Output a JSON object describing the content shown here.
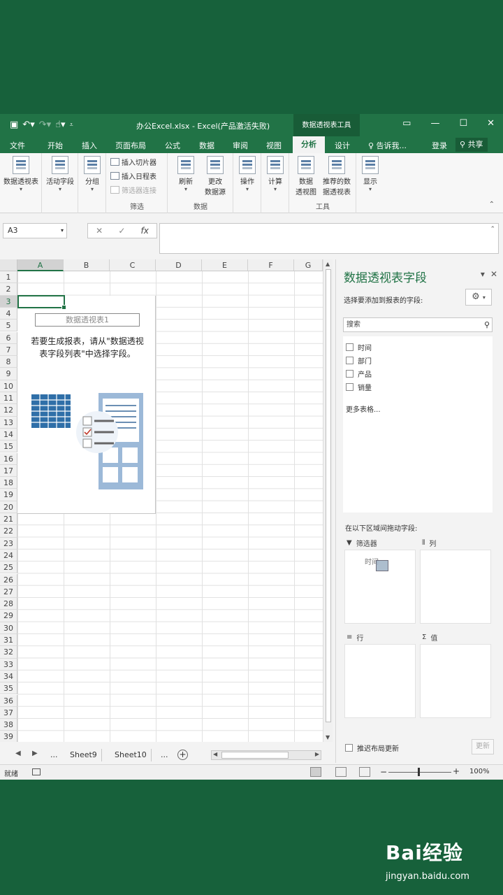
{
  "app": {
    "document_title": "办公Excel.xlsx - Excel(产品激活失败)",
    "context_tab": "数据透视表工具"
  },
  "ribbon_tabs": [
    "文件",
    "开始",
    "插入",
    "页面布局",
    "公式",
    "数据",
    "审阅",
    "视图",
    "分析",
    "设计"
  ],
  "tell_me": "♀ 告诉我...",
  "login": "登录",
  "share": "共享",
  "ribbon": {
    "pivot_table": "数据透视表",
    "active_field": "活动字段",
    "group": "分组",
    "insert_slicer": "插入切片器",
    "insert_timeline": "插入日程表",
    "filter_connections": "筛选器连接",
    "filter_group": "筛选",
    "refresh": "刷新",
    "change_source_1": "更改",
    "change_source_2": "数据源",
    "data_group": "数据",
    "actions": "操作",
    "calculations": "计算",
    "pivot_chart_1": "数据",
    "pivot_chart_2": "透视图",
    "recommended_1": "推荐的数",
    "recommended_2": "据透视表",
    "tools_group": "工具",
    "show": "显示"
  },
  "formula_bar": {
    "name_box": "A3",
    "fx": "fx",
    "cancel": "✕",
    "enter": "✓",
    "value": ""
  },
  "sheet": {
    "columns": [
      "A",
      "B",
      "C",
      "D",
      "E",
      "F",
      "G"
    ],
    "rows": [
      "1",
      "2",
      "3",
      "4",
      "5",
      "6",
      "7",
      "8",
      "9",
      "10",
      "11",
      "12",
      "13",
      "14",
      "15",
      "16",
      "17",
      "18",
      "19",
      "20",
      "21",
      "22",
      "23",
      "24",
      "25",
      "26",
      "27",
      "28",
      "29",
      "30",
      "31",
      "32",
      "33",
      "34",
      "35",
      "36",
      "37",
      "38",
      "39"
    ],
    "active_cell": "A3"
  },
  "pivot_placeholder": {
    "name": "数据透视表1",
    "message_1": "若要生成报表，请从\"数据透视",
    "message_2": "表字段列表\"中选择字段。"
  },
  "sheet_tabs": {
    "ellipsis_left": "...",
    "tabs": [
      "Sheet9",
      "Sheet10"
    ],
    "ellipsis_right": "..."
  },
  "status": {
    "ready": "就绪",
    "zoom": "100%"
  },
  "field_pane": {
    "title": "数据透视表字段",
    "subtitle": "选择要添加到报表的字段:",
    "search_placeholder": "搜索",
    "fields": [
      "时间",
      "部门",
      "产品",
      "销量"
    ],
    "more_tables": "更多表格...",
    "drag_hint": "在以下区域间拖动字段:",
    "areas": {
      "filters": "筛选器",
      "columns": "列",
      "rows": "行",
      "values": "值"
    },
    "dragging_field": "时间",
    "defer_update": "推迟布局更新",
    "update_button": "更新"
  },
  "watermark": {
    "brand": "Bai经验",
    "url": "jingyan.baidu.com"
  }
}
